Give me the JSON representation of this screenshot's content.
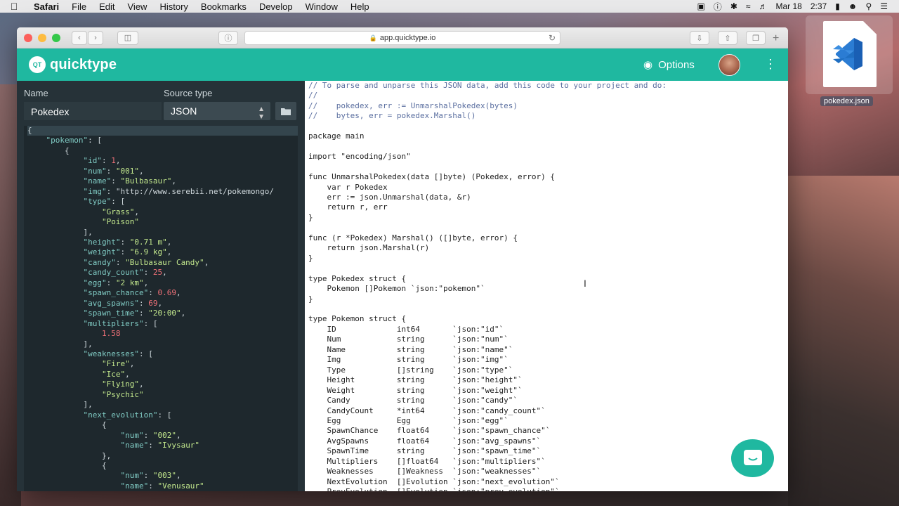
{
  "menubar": {
    "app": "Safari",
    "items": [
      "File",
      "Edit",
      "View",
      "History",
      "Bookmarks",
      "Develop",
      "Window",
      "Help"
    ],
    "date": "Mar 18",
    "time": "2:37"
  },
  "browser": {
    "url": "app.quicktype.io"
  },
  "app": {
    "logo_text": "QT",
    "brand": "quicktype",
    "options_label": "Options"
  },
  "sidebar": {
    "name_label": "Name",
    "name_value": "Pokedex",
    "source_label": "Source type",
    "source_value": "JSON"
  },
  "json_lines": [
    "{",
    "    \"pokemon\": [",
    "        {",
    "            \"id\": 1,",
    "            \"num\": \"001\",",
    "            \"name\": \"Bulbasaur\",",
    "            \"img\": \"http://www.serebii.net/pokemongo/",
    "            \"type\": [",
    "                \"Grass\",",
    "                \"Poison\"",
    "            ],",
    "            \"height\": \"0.71 m\",",
    "            \"weight\": \"6.9 kg\",",
    "            \"candy\": \"Bulbasaur Candy\",",
    "            \"candy_count\": 25,",
    "            \"egg\": \"2 km\",",
    "            \"spawn_chance\": 0.69,",
    "            \"avg_spawns\": 69,",
    "            \"spawn_time\": \"20:00\",",
    "            \"multipliers\": [",
    "                1.58",
    "            ],",
    "            \"weaknesses\": [",
    "                \"Fire\",",
    "                \"Ice\",",
    "                \"Flying\",",
    "                \"Psychic\"",
    "            ],",
    "            \"next_evolution\": [",
    "                {",
    "                    \"num\": \"002\",",
    "                    \"name\": \"Ivysaur\"",
    "                },",
    "                {",
    "                    \"num\": \"003\",",
    "                    \"name\": \"Venusaur\""
  ],
  "code_lines": [
    "// To parse and unparse this JSON data, add this code to your project and do:",
    "//",
    "//    pokedex, err := UnmarshalPokedex(bytes)",
    "//    bytes, err = pokedex.Marshal()",
    "",
    "package main",
    "",
    "import \"encoding/json\"",
    "",
    "func UnmarshalPokedex(data []byte) (Pokedex, error) {",
    "    var r Pokedex",
    "    err := json.Unmarshal(data, &r)",
    "    return r, err",
    "}",
    "",
    "func (r *Pokedex) Marshal() ([]byte, error) {",
    "    return json.Marshal(r)",
    "}",
    "",
    "type Pokedex struct {",
    "    Pokemon []Pokemon `json:\"pokemon\"`",
    "}",
    "",
    "type Pokemon struct {",
    "    ID             int64       `json:\"id\"`",
    "    Num            string      `json:\"num\"`",
    "    Name           string      `json:\"name\"`",
    "    Img            string      `json:\"img\"`",
    "    Type           []string    `json:\"type\"`",
    "    Height         string      `json:\"height\"`",
    "    Weight         string      `json:\"weight\"`",
    "    Candy          string      `json:\"candy\"`",
    "    CandyCount     *int64      `json:\"candy_count\"`",
    "    Egg            Egg         `json:\"egg\"`",
    "    SpawnChance    float64     `json:\"spawn_chance\"`",
    "    AvgSpawns      float64     `json:\"avg_spawns\"`",
    "    SpawnTime      string      `json:\"spawn_time\"`",
    "    Multipliers    []float64   `json:\"multipliers\"`",
    "    Weaknesses     []Weakness  `json:\"weaknesses\"`",
    "    NextEvolution  []Evolution `json:\"next_evolution\"`",
    "    PrevEvolution  []Evolution `json:\"prev_evolution\"`"
  ],
  "desktop": {
    "file_label": "pokedex.json"
  }
}
